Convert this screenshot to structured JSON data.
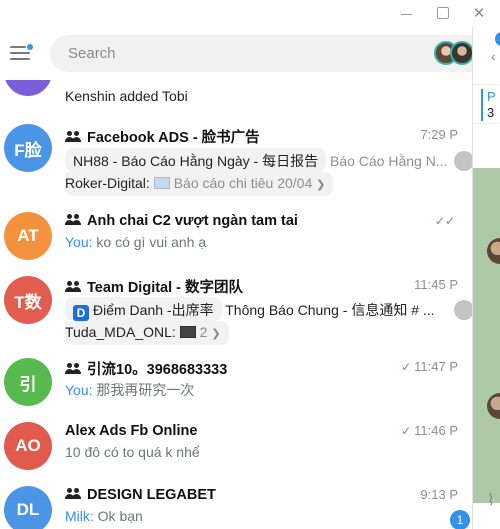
{
  "search": {
    "placeholder": "Search"
  },
  "window": {
    "close_glyph": "✕"
  },
  "chats": [
    {
      "avatar_initials": "",
      "avatar_color": "#7b5fd8",
      "name": "",
      "preview_text": "Kenshin added Tobi"
    },
    {
      "avatar_initials": "F脸",
      "avatar_color": "#4a95e6",
      "is_group": true,
      "name": "Facebook ADS - 脸书广告",
      "time": "7:29 P",
      "topics": [
        {
          "name": "NH88 - Báo Cáo Hằng Ngày - 每日报告",
          "sub": "Báo Cáo Hằng N..."
        }
      ],
      "sender": "Roker-Digital:",
      "message": "Báo cáo chi tiêu 20/04",
      "arrow": "❯",
      "badge": ""
    },
    {
      "avatar_initials": "AT",
      "avatar_color": "#f5923e",
      "is_group": true,
      "name": "Anh chai C2 vượt ngàn tam tai",
      "time": "",
      "checks": "✓✓",
      "sender": "You:",
      "message": "ko có gì vui anh ạ"
    },
    {
      "avatar_initials": "T数",
      "avatar_color": "#e35c50",
      "is_group": true,
      "name": "Team Digital - 数字团队",
      "time": "11:45 P",
      "topic_icon": "D",
      "topics": [
        {
          "name": "Điểm Danh -出席率",
          "sub": "Thông Báo Chung - 信息通知 # ..."
        }
      ],
      "sender": "Tuda_MDA_ONL:",
      "message": "2",
      "arrow": "❯"
    },
    {
      "avatar_initials": "引",
      "avatar_color": "#58b94f",
      "is_group": true,
      "name": "引流10。3968683333",
      "time": "11:47 P",
      "checks": "✓",
      "sender": "You:",
      "message": "那我再研究一次"
    },
    {
      "avatar_initials": "AO",
      "avatar_color": "#e15a4e",
      "is_group": false,
      "name": "Alex Ads Fb Online",
      "time": "11:46 P",
      "checks": "✓",
      "sender": "",
      "message": "10 đô có to quá k nhể"
    },
    {
      "avatar_initials": "DL",
      "avatar_color": "#4a95e6",
      "is_group": true,
      "name": "DESIGN LEGABET",
      "time": "9:13 P",
      "sender": "Milk:",
      "message": "Ok bạn",
      "badge": "1"
    }
  ],
  "right_panel": {
    "pinned_title": "P",
    "pinned_number": "3"
  },
  "colors": {
    "accent": "#3390ec",
    "read_check": "#4fae4e"
  },
  "icons": [
    "menu-icon",
    "group-icon",
    "double-check-icon",
    "paperclip-icon",
    "back-icon"
  ]
}
